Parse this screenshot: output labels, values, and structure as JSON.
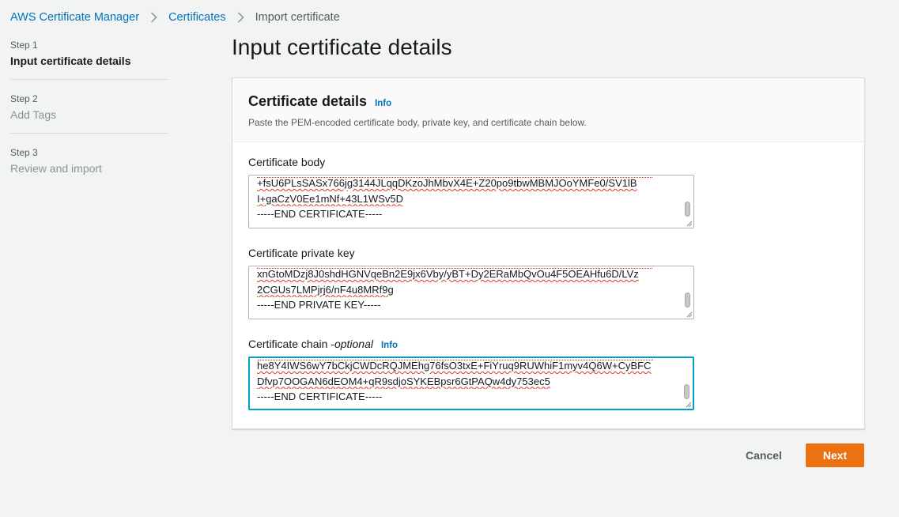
{
  "breadcrumb": {
    "items": [
      "AWS Certificate Manager",
      "Certificates"
    ],
    "current": "Import certificate"
  },
  "steps": [
    {
      "num": "Step 1",
      "title": "Input certificate details",
      "active": true
    },
    {
      "num": "Step 2",
      "title": "Add Tags",
      "active": false
    },
    {
      "num": "Step 3",
      "title": "Review and import",
      "active": false
    }
  ],
  "page_title": "Input certificate details",
  "panel": {
    "title": "Certificate details",
    "info": "Info",
    "description": "Paste the PEM-encoded certificate body, private key, and certificate chain below."
  },
  "fields": {
    "body": {
      "label": "Certificate body",
      "lines": [
        "+fsU6PLsSASx766jg3144JLqqDKzoJhMbvX4E+Z20po9tbwMBMJOoYMFe0/SV1lB",
        "I+gaCzV0Ee1mNf+43L1WSv5D",
        "-----END CERTIFICATE-----"
      ]
    },
    "private_key": {
      "label": "Certificate private key",
      "lines": [
        "xnGtoMDzj8J0shdHGNVqeBn2E9jx6Vby/yBT+Dy2ERaMbQvOu4F5OEAHfu6D/LVz",
        "2CGUs7LMPjrj6/nF4u8MRf9g",
        "-----END PRIVATE KEY-----"
      ]
    },
    "chain": {
      "label": "Certificate chain - ",
      "optional": "optional",
      "info": "Info",
      "lines": [
        "he8Y4IWS6wY7bCkjCWDcRQJMEhg76fsO3txE+FiYruq9RUWhiF1myv4Q6W+CyBFC",
        "Dfvp7OOGAN6dEOM4+qR9sdjoSYKEBpsr6GtPAQw4dy753ec5",
        "-----END CERTIFICATE-----"
      ]
    }
  },
  "footer": {
    "cancel": "Cancel",
    "next": "Next"
  },
  "colors": {
    "primary_button": "#ec7211",
    "link": "#0073bb",
    "focus": "#00a1c9"
  }
}
